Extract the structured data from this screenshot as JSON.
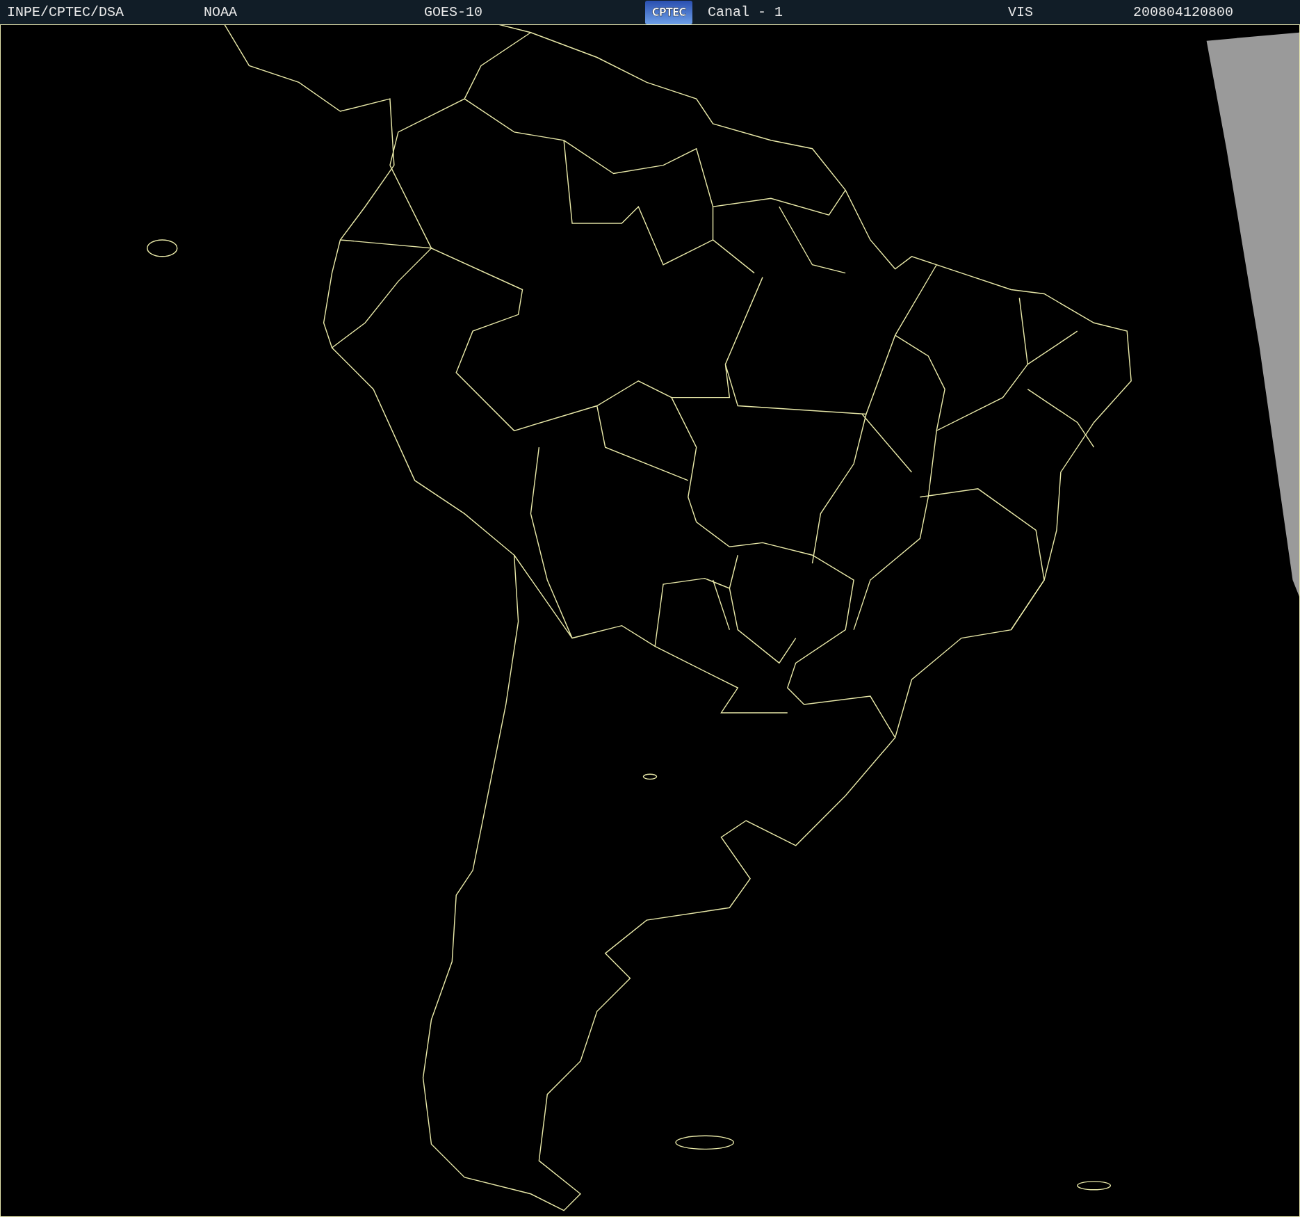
{
  "header": {
    "items": [
      {
        "kind": "text",
        "text": "INPE/CPTEC/DSA"
      },
      {
        "kind": "text",
        "text": "NOAA"
      },
      {
        "kind": "text",
        "text": "GOES-10"
      },
      {
        "kind": "logo",
        "text": "CPTEC"
      },
      {
        "kind": "text",
        "text": "Canal - 1"
      },
      {
        "kind": "text",
        "text": "VIS"
      },
      {
        "kind": "text",
        "text": "200804120800"
      }
    ]
  }
}
